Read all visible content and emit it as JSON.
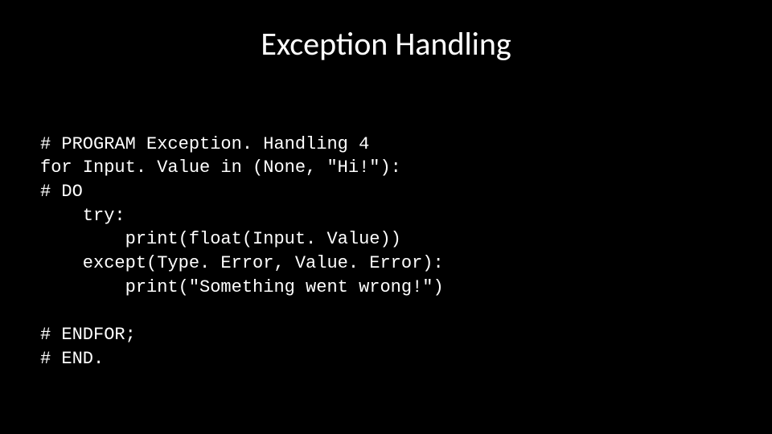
{
  "title": "Exception Handling",
  "code": {
    "l1": "# PROGRAM Exception. Handling 4",
    "l2": "for Input. Value in (None, \"Hi!\"):",
    "l3": "# DO",
    "l4": "    try:",
    "l5": "        print(float(Input. Value))",
    "l6": "    except(Type. Error, Value. Error):",
    "l7": "        print(\"Something went wrong!\")",
    "l8": "",
    "l9": "# ENDFOR;",
    "l10": "# END."
  }
}
